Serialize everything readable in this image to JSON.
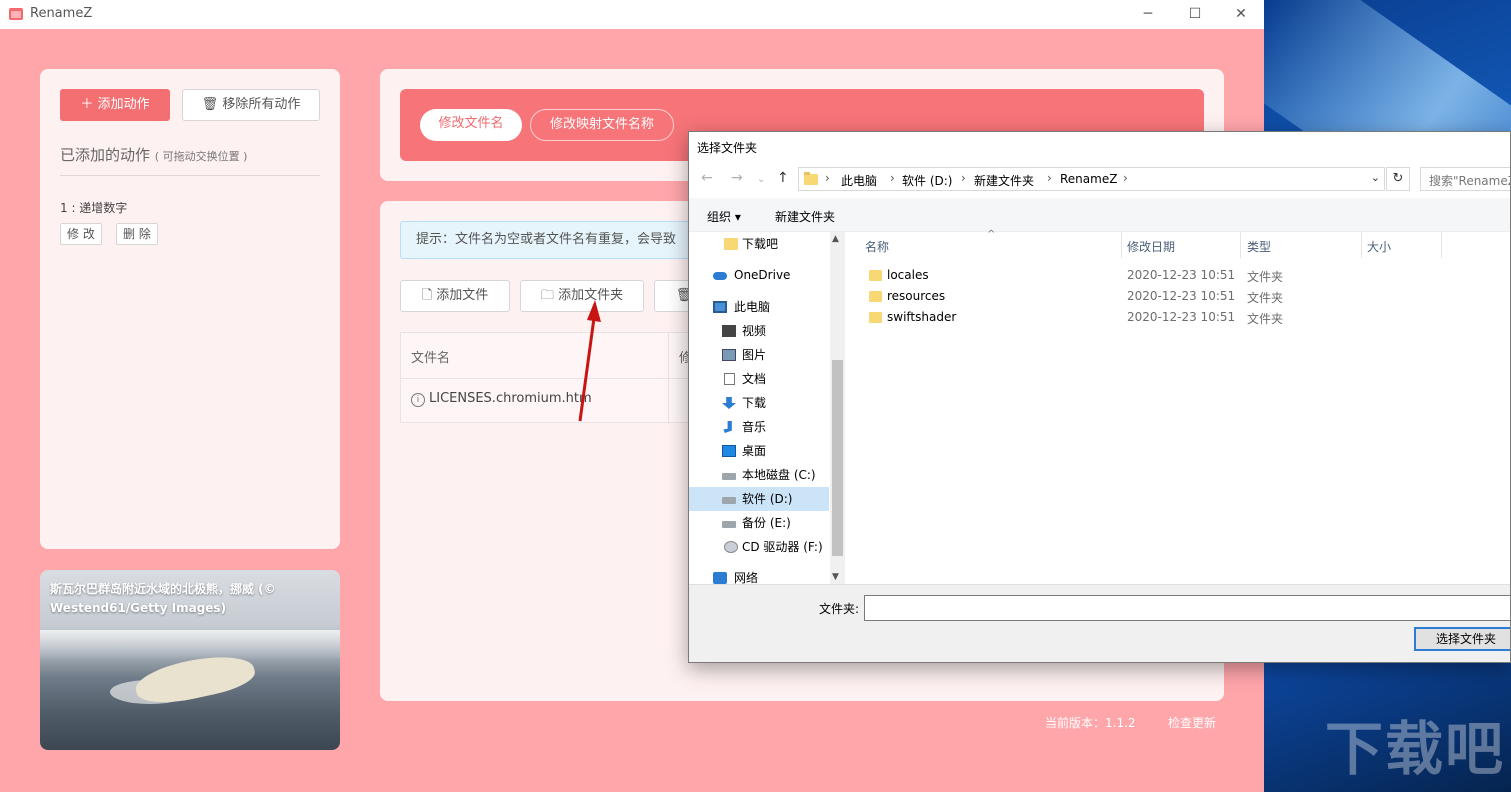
{
  "app": {
    "title": "RenameZ",
    "window_controls": {
      "minimize": "─",
      "maximize": "☐",
      "close": "✕"
    }
  },
  "left_panel": {
    "add_action_label": "添加动作",
    "remove_all_label": "移除所有动作",
    "actions_title": "已添加的动作",
    "actions_hint": "( 可拖动交换位置 )",
    "actions": [
      {
        "label": "1 : 递增数字",
        "edit_label": "修 改",
        "delete_label": "删 除"
      }
    ]
  },
  "photo": {
    "caption": "斯瓦尔巴群岛附近水域的北极熊，挪威 (© Westend61/Getty Images)"
  },
  "mode_tabs": [
    {
      "label": "修改文件名",
      "active": true
    },
    {
      "label": "修改映射文件名称",
      "active": false
    }
  ],
  "main": {
    "tip": "提示：文件名为空或者文件名有重复，会导致",
    "add_file_label": "添加文件",
    "add_folder_label": "添加文件夹",
    "table": {
      "col1_header": "文件名",
      "col2_header": "修",
      "rows": [
        {
          "name": "LICENSES.chromium.htm"
        }
      ]
    }
  },
  "footer": {
    "version": "当前版本：1.1.2",
    "check_update": "检查更新"
  },
  "dialog": {
    "title": "选择文件夹",
    "breadcrumbs": [
      "此电脑",
      "软件 (D:)",
      "新建文件夹",
      "RenameZ"
    ],
    "search_placeholder": "搜索\"RenameZ\"",
    "toolbar": {
      "organize": "组织 ▾",
      "new_folder": "新建文件夹"
    },
    "nav_items": [
      {
        "label": "下载吧",
        "icon": "folder-icon"
      },
      {
        "label": "OneDrive",
        "icon": "onedrive-icon"
      },
      {
        "label": "此电脑",
        "icon": "computer-icon"
      },
      {
        "label": "视频",
        "icon": "video-icon"
      },
      {
        "label": "图片",
        "icon": "pictures-icon"
      },
      {
        "label": "文档",
        "icon": "documents-icon"
      },
      {
        "label": "下载",
        "icon": "download-icon"
      },
      {
        "label": "音乐",
        "icon": "music-icon"
      },
      {
        "label": "桌面",
        "icon": "desktop-icon"
      },
      {
        "label": "本地磁盘 (C:)",
        "icon": "drive-icon"
      },
      {
        "label": "软件 (D:)",
        "icon": "drive-icon",
        "selected": true
      },
      {
        "label": "备份 (E:)",
        "icon": "drive-icon"
      },
      {
        "label": "CD 驱动器 (F:)",
        "icon": "cd-drive-icon"
      },
      {
        "label": "网络",
        "icon": "network-icon"
      }
    ],
    "columns": {
      "name": "名称",
      "modified": "修改日期",
      "type": "类型",
      "size": "大小"
    },
    "files": [
      {
        "name": "locales",
        "modified": "2020-12-23 10:51",
        "type": "文件夹"
      },
      {
        "name": "resources",
        "modified": "2020-12-23 10:51",
        "type": "文件夹"
      },
      {
        "name": "swiftshader",
        "modified": "2020-12-23 10:51",
        "type": "文件夹"
      }
    ],
    "folder_label": "文件夹:",
    "folder_value": "",
    "select_button": "选择文件夹"
  },
  "watermark": "下载吧",
  "colors": {
    "app_bg": "#ffa6ab",
    "accent": "#f36f72",
    "mode_bar": "#f77479",
    "selection": "#cce4f7"
  }
}
